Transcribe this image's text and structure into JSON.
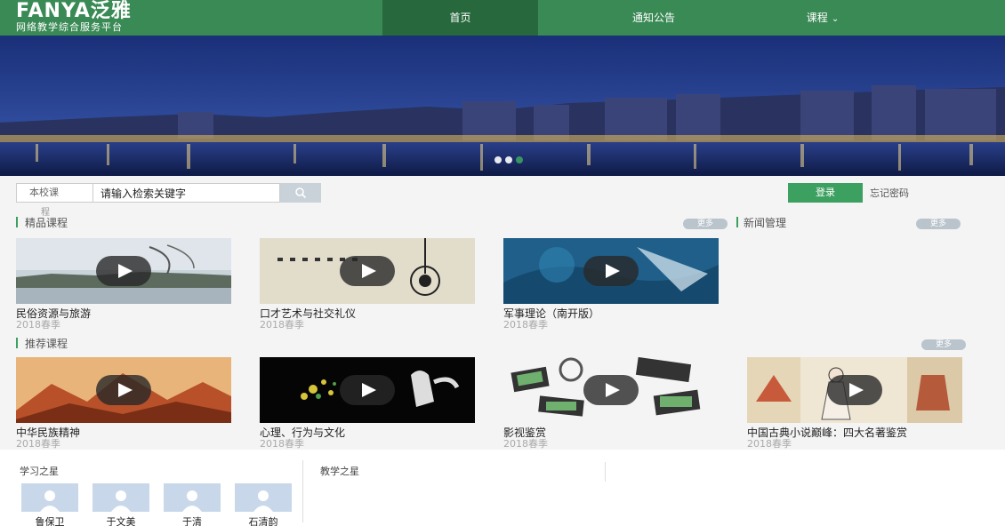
{
  "header": {
    "logo_main": "FANYA泛雅",
    "logo_sub": "网络教学综合服务平台",
    "nav": [
      {
        "label": "首页"
      },
      {
        "label": "通知公告"
      },
      {
        "label": "课程"
      }
    ],
    "nav_chevron": "⌄"
  },
  "search": {
    "type_label": "本校课",
    "type_label_sub": "程",
    "input_value": "请输入检索关键字",
    "button_icon": "search-icon"
  },
  "auth": {
    "login_label": "登录",
    "forgot_label": "忘记密码"
  },
  "featured": {
    "title": "精品课程",
    "more_label": "更多",
    "courses": [
      {
        "name": "民俗资源与旅游",
        "term": "2018春季"
      },
      {
        "name": "口才艺术与社交礼仪",
        "term": "2018春季"
      },
      {
        "name": "军事理论（南开版）",
        "term": "2018春季"
      }
    ]
  },
  "news": {
    "title": "新闻管理",
    "more_label": "更多"
  },
  "recommended": {
    "title": "推荐课程",
    "more_label": "更多",
    "courses": [
      {
        "name": "中华民族精神",
        "term": "2018春季"
      },
      {
        "name": "心理、行为与文化",
        "term": "2018春季"
      },
      {
        "name": "影视鉴赏",
        "term": "2018春季"
      },
      {
        "name": "中国古典小说巅峰：四大名著鉴赏",
        "term": "2018春季"
      }
    ]
  },
  "bottom": {
    "study_stars_title": "学习之星",
    "teach_stars_title": "教学之星",
    "study_stars": [
      "鲁保卫",
      "于文美",
      "于清",
      "石清韵"
    ]
  },
  "colors": {
    "header_green": "#3a8a55",
    "active_nav": "#27683d",
    "accent_green": "#3ca060"
  }
}
